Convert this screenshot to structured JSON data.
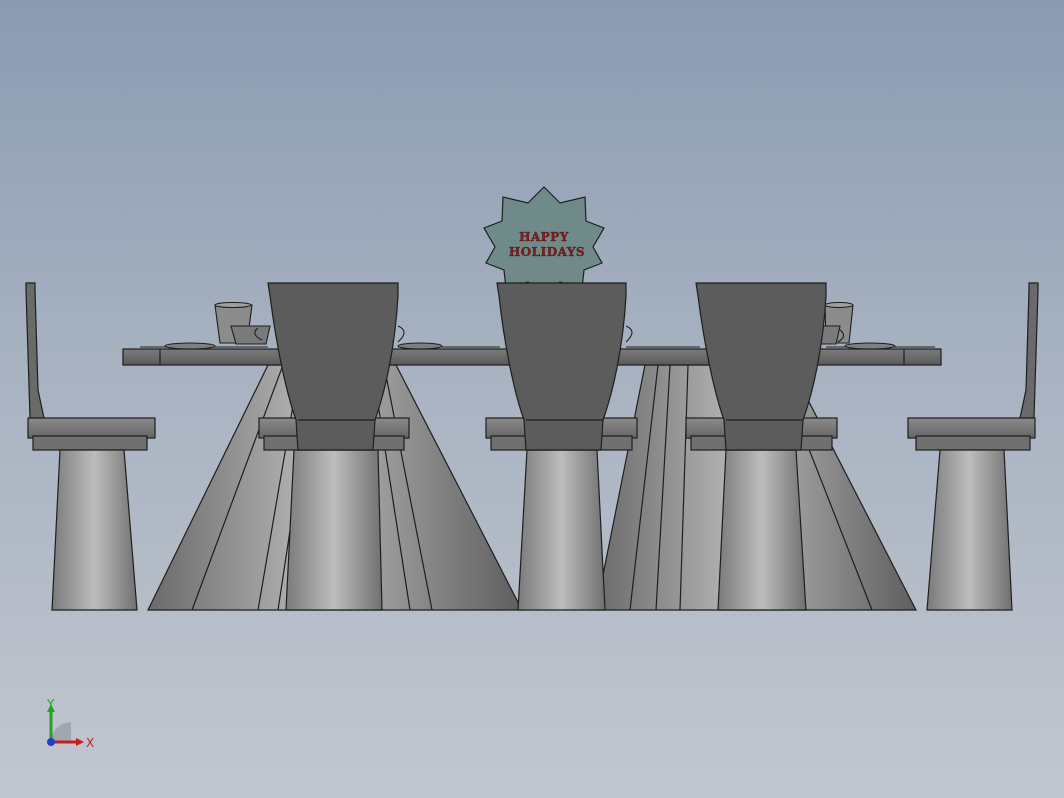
{
  "viewport": {
    "background_top": "#8b9bb1",
    "background_bottom": "#c2c6cf"
  },
  "model": {
    "centerpiece_text_line1": "HAPPY",
    "centerpiece_text_line2": "HOLIDAYS",
    "centerpiece_color": "#6f8a88",
    "part_color": "#5c5c5c",
    "edge_color": "#1e1e1e"
  },
  "triad": {
    "x_label": "X",
    "y_label": "Y",
    "x_color": "#c81e1e",
    "y_color": "#28a028"
  }
}
